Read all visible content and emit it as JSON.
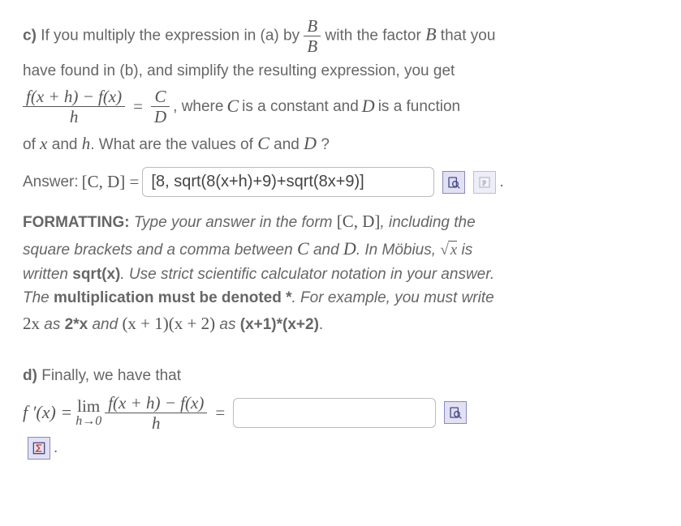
{
  "partC": {
    "label": "c)",
    "text1": "If you multiply the expression in (a) by",
    "fracB_num": "B",
    "fracB_den": "B",
    "text2": "with the factor",
    "B": "B",
    "text3": "that you",
    "text4": "have found in (b), and simplify the resulting expression, you get",
    "diffq_num": "f(x + h) − f(x)",
    "diffq_den": "h",
    "eq": "=",
    "fracCD_num": "C",
    "fracCD_den": "D",
    "text5": ", where",
    "C": "C",
    "text6": "is a constant and",
    "D": "D",
    "text7": "is a function",
    "text8": "of",
    "x": "x",
    "text9": "and",
    "h": "h",
    "text10": ". What are the values of",
    "text11": "and",
    "text12": "?",
    "answer_label": "Answer:",
    "answer_lhs": "[C, D] =",
    "answer_value": "[8, sqrt(8(x+h)+9)+sqrt(8x+9)]",
    "period": "."
  },
  "formatting": {
    "heading": "FORMATTING:",
    "t1": "Type your answer in the form",
    "cd": "[C, D]",
    "t2": ", including the",
    "t3": "square brackets and a comma between",
    "C": "C",
    "t4": "and",
    "D": "D",
    "t5": ". In Möbius,",
    "sqrt_inner": "x",
    "t6": "is",
    "t7": "written",
    "sqrtx": "sqrt(x)",
    "t8": ". Use strict scientific calculator notation in your answer.",
    "t9": "The",
    "mult": "multiplication must be denoted *",
    "t10": ".  For example, you must write",
    "twox_math": "2x",
    "t11": "as",
    "twox_txt": "2*x",
    "t12": "and",
    "prod_math": "(x + 1)(x + 2)",
    "t13": "as",
    "prod_txt": "(x+1)*(x+2)",
    "t14": "."
  },
  "partD": {
    "label": "d)",
    "text1": "Finally, we have that",
    "fprime": "f ′(x) =",
    "lim_top": "lim",
    "lim_bot": "h→0",
    "diffq_num": "f(x + h) − f(x)",
    "diffq_den": "h",
    "eq": "=",
    "answer_value": "",
    "period": "."
  }
}
